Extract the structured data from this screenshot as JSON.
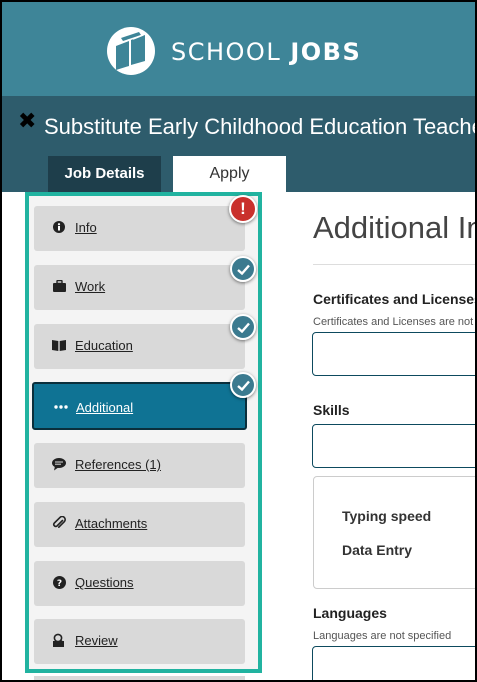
{
  "header": {
    "brand_part1": "SCHOOL",
    "brand_part2": "JOBS"
  },
  "job": {
    "title": "Substitute Early Childhood Education Teacher"
  },
  "tabs": [
    {
      "label": "Job Details"
    },
    {
      "label": "Apply"
    }
  ],
  "sidebar": {
    "items": [
      {
        "label": "Info",
        "icon": "info-icon",
        "status": "error"
      },
      {
        "label": "Work",
        "icon": "briefcase-icon",
        "status": "complete"
      },
      {
        "label": "Education",
        "icon": "book-icon",
        "status": "complete"
      },
      {
        "label": "Additional",
        "icon": "ellipsis-icon",
        "status": "complete",
        "active": true
      },
      {
        "label": "References (1)",
        "icon": "comment-icon",
        "status": "none"
      },
      {
        "label": "Attachments",
        "icon": "paperclip-icon",
        "status": "none"
      },
      {
        "label": "Questions",
        "icon": "question-icon",
        "status": "none"
      },
      {
        "label": "Review",
        "icon": "review-icon",
        "status": "none"
      }
    ]
  },
  "main": {
    "title": "Additional Information",
    "certificates": {
      "label": "Certificates and Licenses",
      "help": "Certificates and Licenses are not specified"
    },
    "skills": {
      "label": "Skills",
      "items": [
        "Typing speed",
        "Data Entry"
      ]
    },
    "languages": {
      "label": "Languages",
      "help": "Languages are not specified"
    }
  },
  "colors": {
    "header": "#3e8598",
    "titlebar": "#2e5c6c",
    "active_tab": "#1e3e4b",
    "sidebar_border": "#21b3a0",
    "active_item": "#0f7394",
    "error_badge": "#c9302c",
    "ok_badge": "#3b7a8f"
  }
}
